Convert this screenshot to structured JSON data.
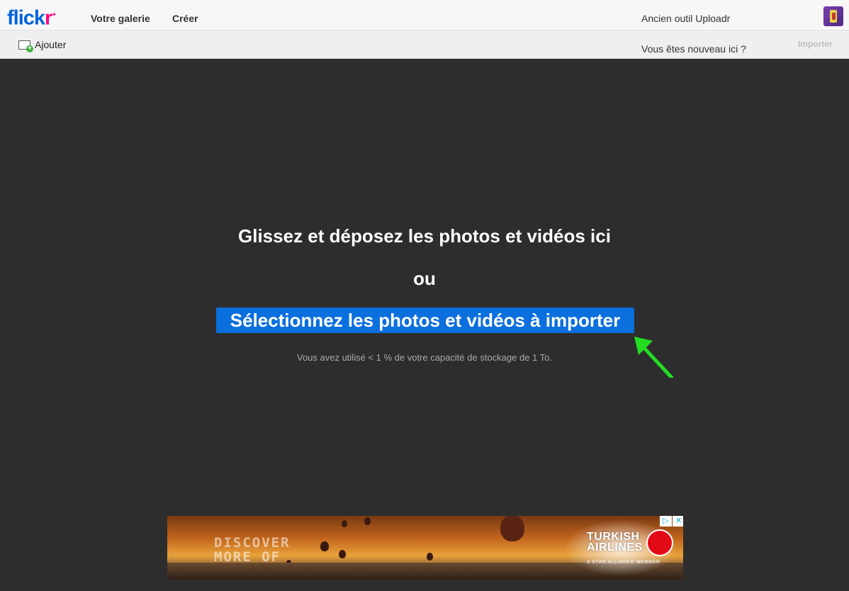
{
  "header": {
    "logo_main": "flick",
    "logo_r": "r",
    "logo_dot": "•",
    "nav": [
      {
        "label": "Votre galerie"
      },
      {
        "label": "Créer"
      }
    ],
    "legacy_link": "Ancien outil Uploadr"
  },
  "toolbar": {
    "add_label": "Ajouter",
    "new_here": "Vous êtes nouveau ici ?",
    "import_label": "Importer"
  },
  "dropzone": {
    "title": "Glissez et déposez les photos et vidéos ici",
    "or": "ou",
    "select_label": "Sélectionnez les photos et vidéos à importer",
    "storage_text": "Vous avez utilisé < 1 % de votre capacité de stockage de 1 To."
  },
  "ad": {
    "headline": "DISCOVER MORE OF",
    "brand_line1": "TURKISH",
    "brand_line2": "AIRLINES",
    "tagline": "A STAR ALLIANCE MEMBER",
    "choices": [
      "▷",
      "✕"
    ]
  },
  "colors": {
    "accent": "#0b6fde",
    "arrow": "#22dd22",
    "logo_blue": "#0063dc",
    "logo_pink": "#ff0084"
  }
}
